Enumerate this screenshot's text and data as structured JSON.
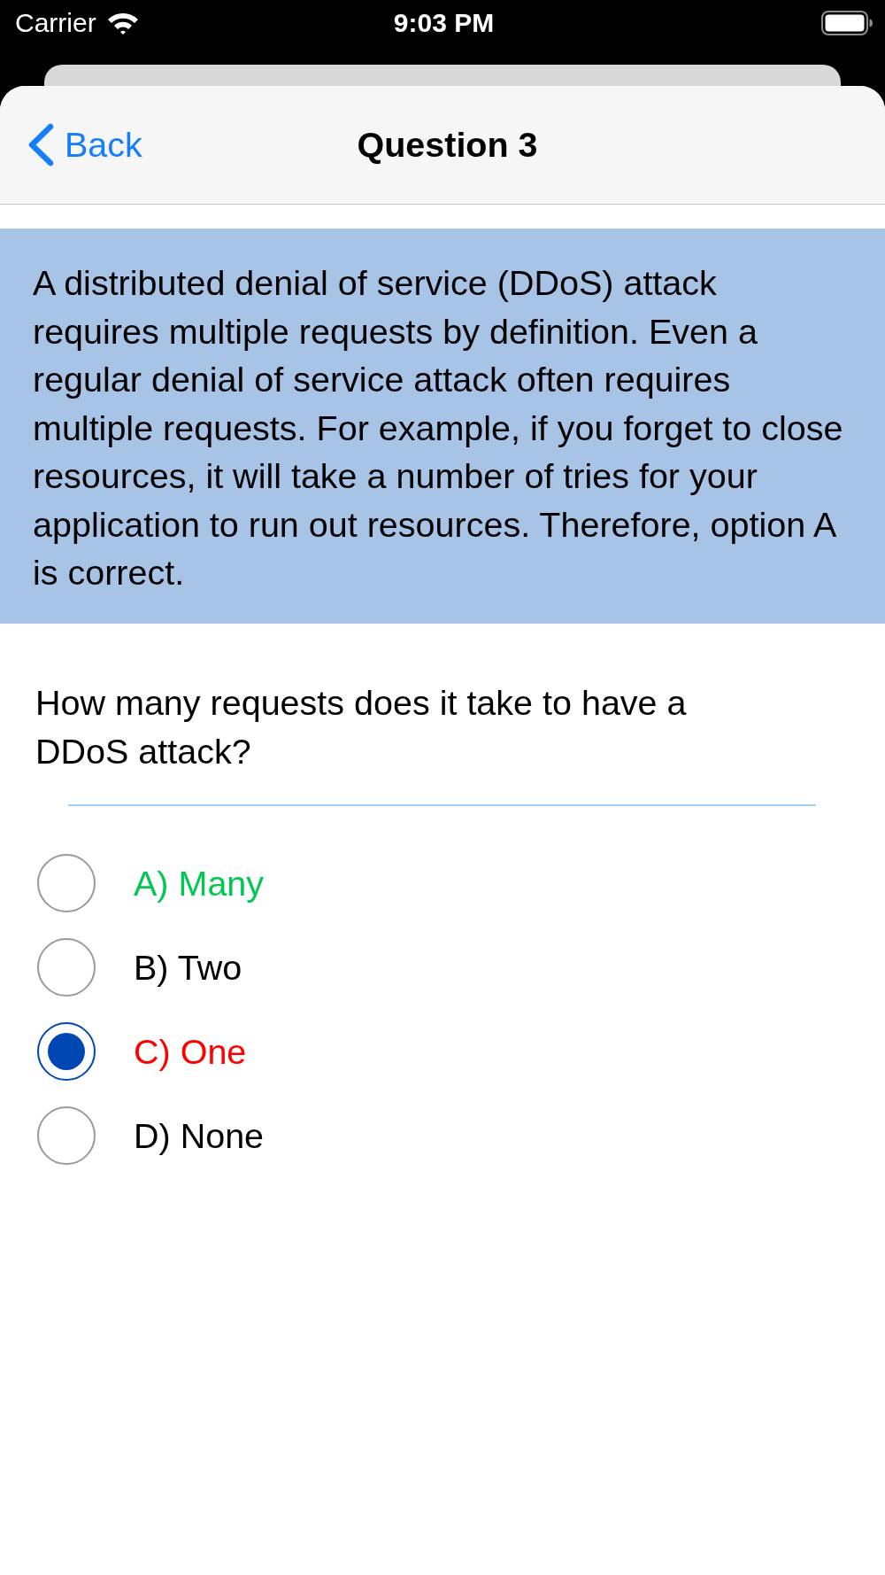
{
  "status_bar": {
    "carrier": "Carrier",
    "time": "9:03 PM"
  },
  "nav_bar": {
    "back_label": "Back",
    "title": "Question 3"
  },
  "explanation": {
    "text": "A distributed denial of service (DDoS) attack requires multiple requests by definition. Even a regular denial of service attack often requires multiple requests. For example, if you forget to close resources, it will take a number of tries for your application to run out resources. Therefore, option A is correct."
  },
  "question": {
    "text": "How many requests does it take to have a DDoS attack?"
  },
  "options": [
    {
      "label": "A) Many",
      "selected": false,
      "color": "#00c853"
    },
    {
      "label": "B) Two",
      "selected": false,
      "color": "#000000"
    },
    {
      "label": "C) One",
      "selected": true,
      "color": "#ff0000"
    },
    {
      "label": "D) None",
      "selected": false,
      "color": "#000000"
    }
  ]
}
